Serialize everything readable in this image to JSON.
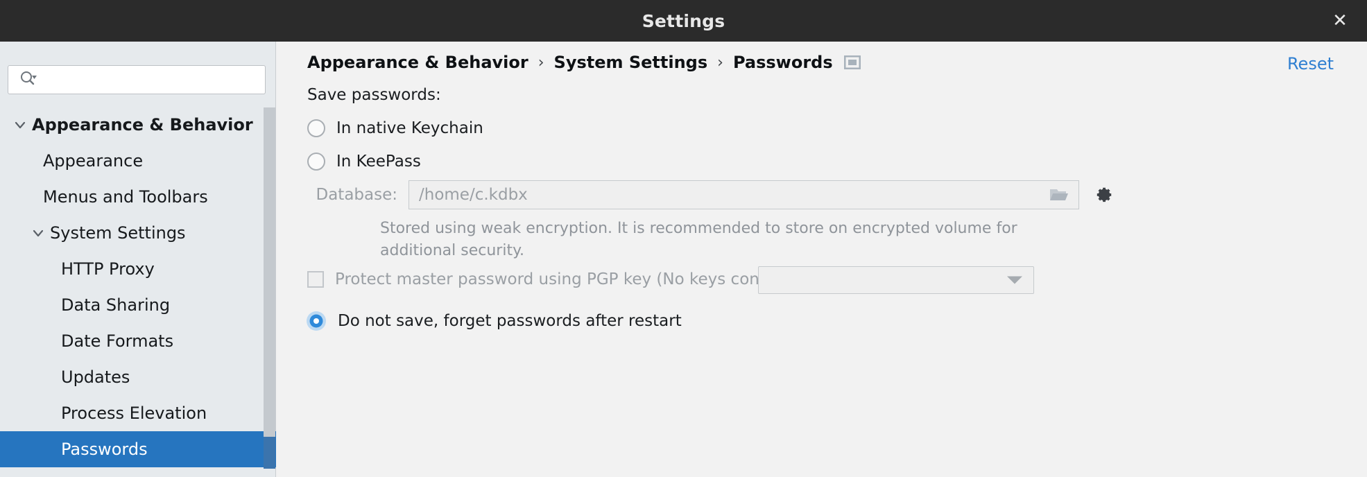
{
  "window": {
    "title": "Settings",
    "close_label": "✕"
  },
  "sidebar": {
    "search": {
      "value": "",
      "placeholder": "",
      "icon": "search-icon"
    },
    "items": [
      {
        "label": "Appearance & Behavior",
        "level": 0,
        "bold": true,
        "expanded": true,
        "selected": false
      },
      {
        "label": "Appearance",
        "level": 1,
        "bold": false,
        "expanded": null,
        "selected": false
      },
      {
        "label": "Menus and Toolbars",
        "level": 1,
        "bold": false,
        "expanded": null,
        "selected": false
      },
      {
        "label": "System Settings",
        "level": 1,
        "bold": false,
        "expanded": true,
        "selected": false
      },
      {
        "label": "HTTP Proxy",
        "level": 2,
        "bold": false,
        "expanded": null,
        "selected": false
      },
      {
        "label": "Data Sharing",
        "level": 2,
        "bold": false,
        "expanded": null,
        "selected": false
      },
      {
        "label": "Date Formats",
        "level": 2,
        "bold": false,
        "expanded": null,
        "selected": false
      },
      {
        "label": "Updates",
        "level": 2,
        "bold": false,
        "expanded": null,
        "selected": false
      },
      {
        "label": "Process Elevation",
        "level": 2,
        "bold": false,
        "expanded": null,
        "selected": false
      },
      {
        "label": "Passwords",
        "level": 2,
        "bold": false,
        "expanded": null,
        "selected": true
      }
    ]
  },
  "main": {
    "breadcrumb": {
      "crumbs": [
        "Appearance & Behavior",
        "System Settings",
        "Passwords"
      ],
      "separator": "›",
      "trailing_icon": "window-icon"
    },
    "reset_label": "Reset",
    "section_label": "Save passwords:",
    "options": [
      {
        "label": "In native Keychain",
        "checked": false
      },
      {
        "label": "In KeePass",
        "checked": false
      },
      {
        "label": "Do not save, forget passwords after restart",
        "checked": true
      }
    ],
    "database": {
      "label": "Database:",
      "value": "/home/c.kdbx",
      "placeholder": "",
      "browse_icon": "folder-icon",
      "settings_icon": "gear-icon",
      "disabled": true
    },
    "hint": "Stored using weak encryption. It is recommended to store on encrypted volume for additional security.",
    "pgp": {
      "label": "Protect master password using PGP key (No keys configured)",
      "checked": false,
      "select_value": "",
      "disabled": true
    }
  },
  "colors": {
    "titlebar_bg": "#2b2b2b",
    "sidebar_bg": "#e6eaed",
    "selection_blue": "#2675bf",
    "link_blue": "#2f7fd1",
    "main_bg": "#f2f2f2",
    "disabled_text": "#9a9fa4"
  }
}
